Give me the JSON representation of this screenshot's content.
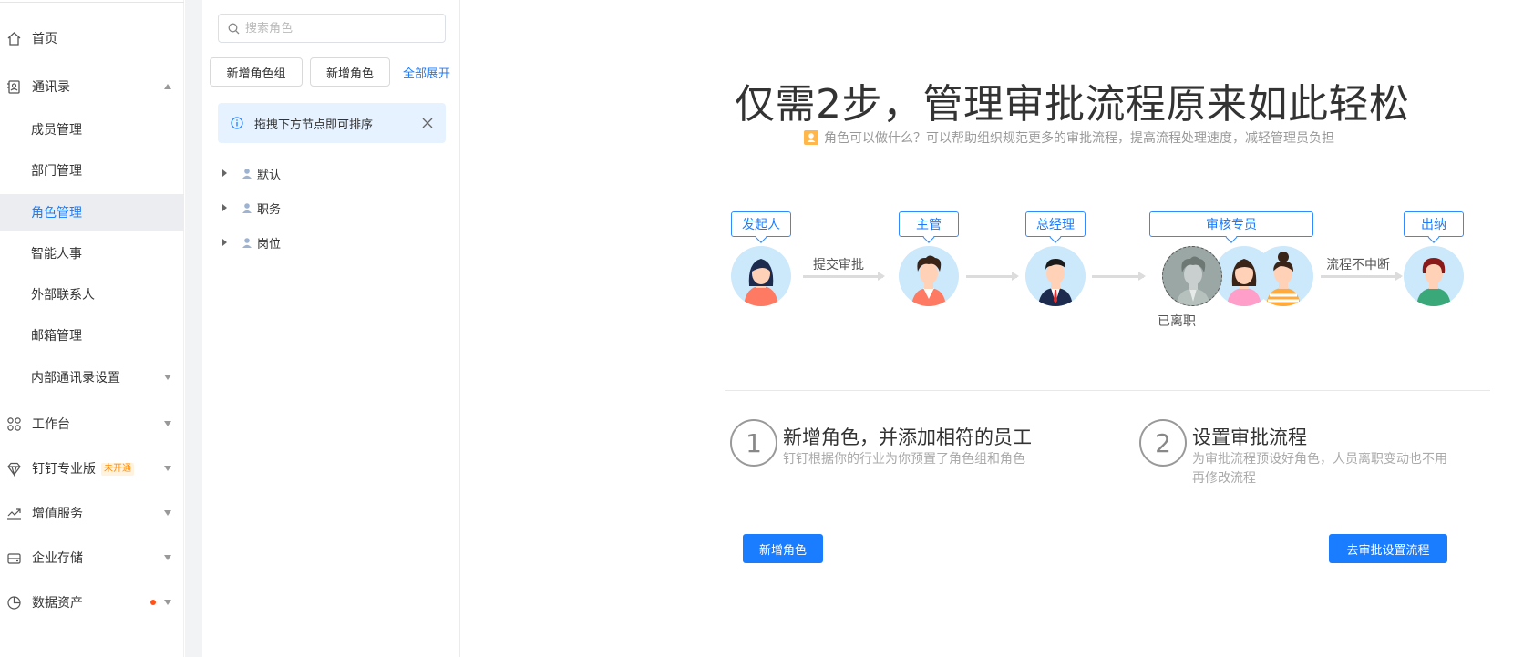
{
  "nav": {
    "items": [
      {
        "label": "首页",
        "icon": "home-icon"
      },
      {
        "label": "通讯录",
        "icon": "contacts-icon"
      },
      {
        "label": "工作台",
        "icon": "apps-icon"
      },
      {
        "label": "钉钉专业版",
        "icon": "diamond-icon",
        "badge": "未开通"
      },
      {
        "label": "增值服务",
        "icon": "trend-icon"
      },
      {
        "label": "企业存储",
        "icon": "storage-icon"
      },
      {
        "label": "数据资产",
        "icon": "pie-icon"
      }
    ],
    "sub_items": [
      {
        "label": "成员管理"
      },
      {
        "label": "部门管理"
      },
      {
        "label": "角色管理",
        "active": true
      },
      {
        "label": "智能人事"
      },
      {
        "label": "外部联系人"
      },
      {
        "label": "邮箱管理"
      },
      {
        "label": "内部通讯录设置"
      }
    ]
  },
  "middle": {
    "search_placeholder": "搜索角色",
    "add_group_label": "新增角色组",
    "add_role_label": "新增角色",
    "expand_all_label": "全部展开",
    "tip_text": "拖拽下方节点即可排序",
    "tree": [
      {
        "label": "默认"
      },
      {
        "label": "职务"
      },
      {
        "label": "岗位"
      }
    ]
  },
  "main": {
    "title": "仅需2步，管理审批流程原来如此轻松",
    "subtitle": "角色可以做什么？可以帮助组织规范更多的审批流程，提高流程处理速度，减轻管理员负担",
    "flow": {
      "tags": [
        "发起人",
        "主管",
        "总经理",
        "审核专员",
        "出纳"
      ],
      "submit_label": "提交审批",
      "continue_label": "流程不中断",
      "left_label": "已离职"
    },
    "steps": [
      {
        "num": "1",
        "title": "新增角色，并添加相符的员工",
        "desc": "钉钉根据你的行业为你预置了角色组和角色"
      },
      {
        "num": "2",
        "title": "设置审批流程",
        "desc": "为审批流程预设好角色，人员离职变动也不用再修改流程"
      }
    ],
    "add_role_button": "新增角色",
    "set_flow_button": "去审批设置流程"
  },
  "colors": {
    "accent": "#1a7dff",
    "active_bg": "#ebedf0",
    "tip_bg": "#e6f2ff",
    "badge": "#ff8a00",
    "dot": "#ff5219"
  }
}
